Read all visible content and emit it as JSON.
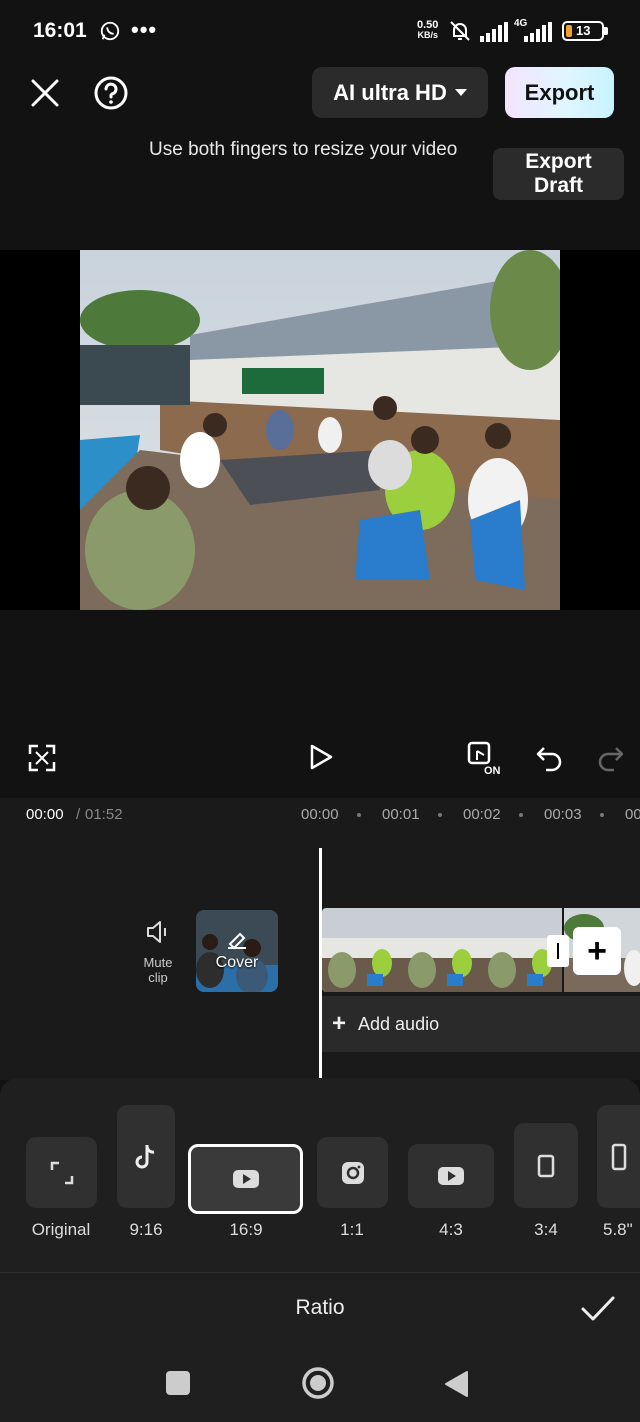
{
  "status_bar": {
    "time": "16:01",
    "more": "•••",
    "net_speed_value": "0.50",
    "net_speed_unit": "KB/s",
    "network": "4G",
    "battery": "13",
    "battery_color": "#f0a030"
  },
  "top_bar": {
    "quality_label": "AI ultra HD",
    "export_label": "Export",
    "hint": "Use both fingers to resize your video",
    "export_draft_line1": "Export",
    "export_draft_line2": "Draft"
  },
  "timeline": {
    "current_time": "00:00",
    "separator": "/",
    "total_time": "01:52",
    "ruler": [
      "00:00",
      "00:01",
      "00:02",
      "00:03",
      "00"
    ],
    "mute_line1": "Mute",
    "mute_line2": "clip",
    "cover_label": "Cover",
    "add_audio_label": "Add audio"
  },
  "ratio_panel": {
    "title": "Ratio",
    "selected": "16:9",
    "options": [
      {
        "label": "Original",
        "icon": "expand-icon"
      },
      {
        "label": "9:16",
        "icon": "tiktok-icon"
      },
      {
        "label": "16:9",
        "icon": "youtube-icon"
      },
      {
        "label": "1:1",
        "icon": "instagram-icon"
      },
      {
        "label": "4:3",
        "icon": "youtube-icon"
      },
      {
        "label": "3:4",
        "icon": "portrait-rect-icon"
      },
      {
        "label": "5.8\"",
        "icon": "phone-icon"
      }
    ]
  },
  "colors": {
    "background": "#121212",
    "panel": "#1f1f1f",
    "accent_export": "#e0f6ff"
  }
}
